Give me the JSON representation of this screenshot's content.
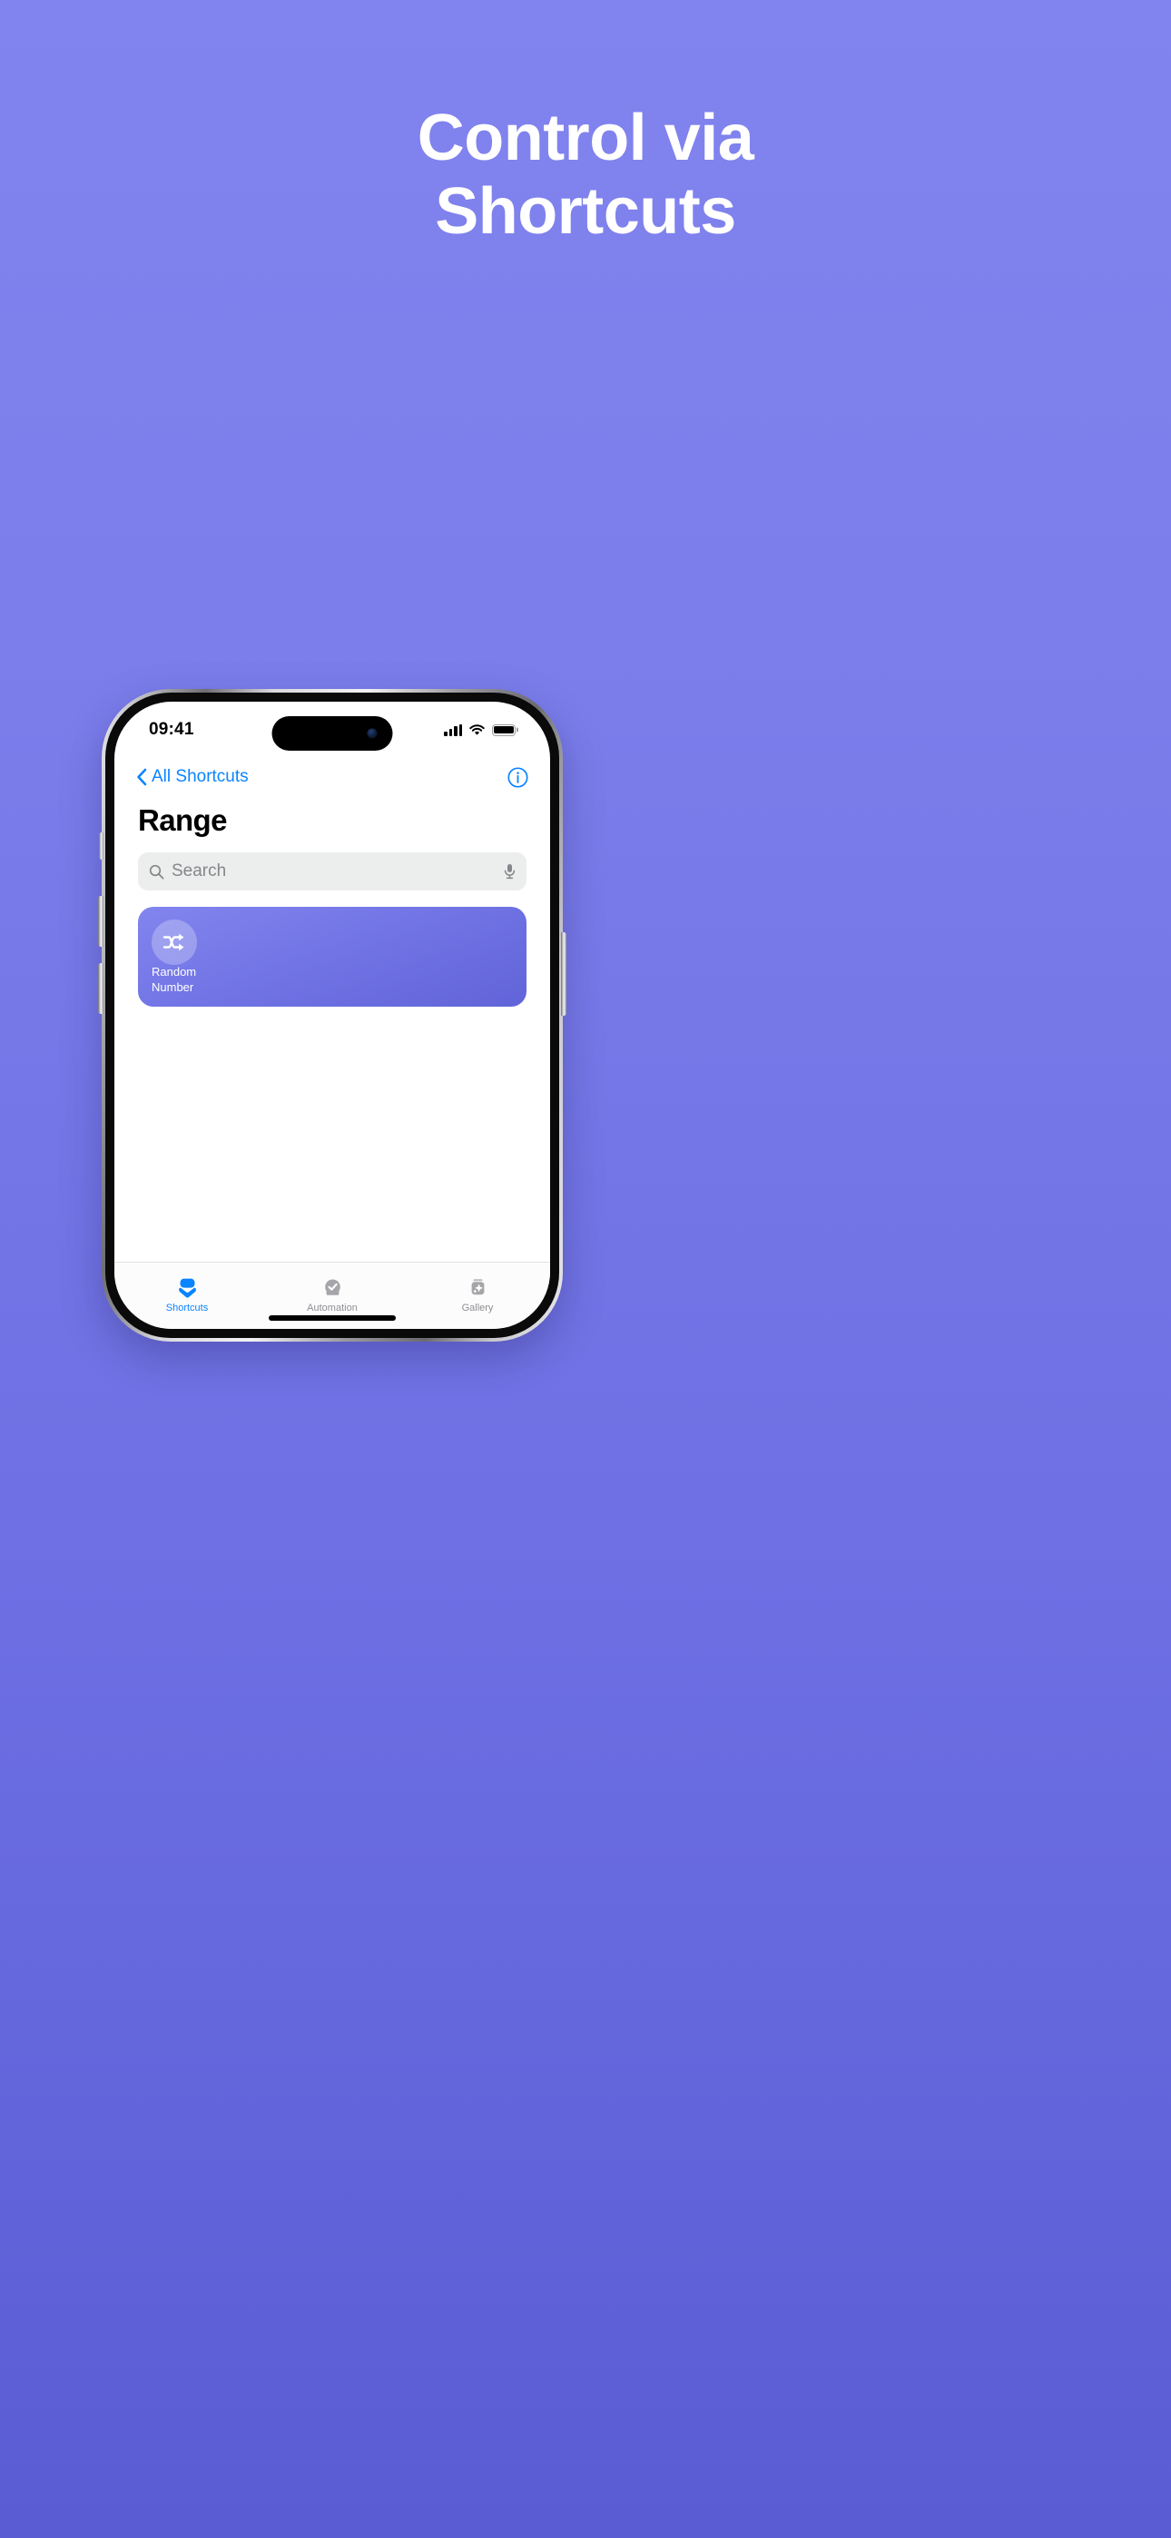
{
  "promo": {
    "title_line1": "Control via",
    "title_line2": "Shortcuts",
    "background_color": "#7b7deb",
    "title_color": "#ffffff"
  },
  "status_bar": {
    "time": "09:41",
    "cellular_icon": "signal-bars-icon",
    "wifi_icon": "wifi-icon",
    "battery_icon": "battery-icon"
  },
  "nav_bar": {
    "back_label": "All Shortcuts",
    "back_icon": "chevron-left-icon",
    "info_icon": "info-circle-icon",
    "accent_color": "#0a84ff"
  },
  "page": {
    "title": "Range"
  },
  "search": {
    "placeholder": "Search",
    "search_icon": "search-icon",
    "mic_icon": "microphone-icon"
  },
  "shortcuts": [
    {
      "name_line1": "Random",
      "name_line2": "Number",
      "icon": "shuffle-icon",
      "tile_color": "#7376e6"
    }
  ],
  "tab_bar": {
    "tabs": [
      {
        "label": "Shortcuts",
        "icon": "layers-icon",
        "active": true
      },
      {
        "label": "Automation",
        "icon": "check-circle-icon",
        "active": false
      },
      {
        "label": "Gallery",
        "icon": "sparkle-cards-icon",
        "active": false
      }
    ],
    "active_color": "#0a84ff",
    "inactive_color": "#8e8e93"
  }
}
